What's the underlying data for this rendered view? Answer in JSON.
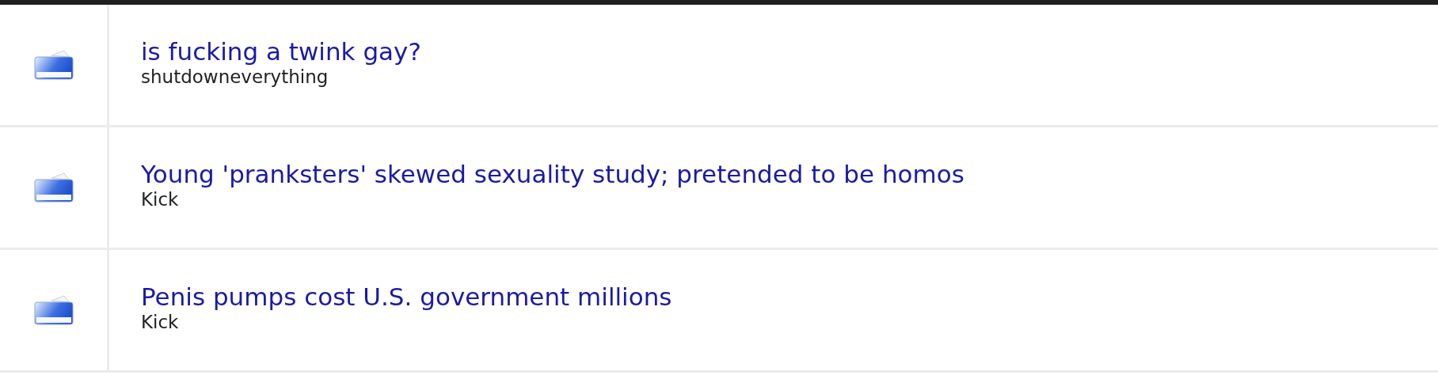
{
  "threads": [
    {
      "title": "is fucking a twink gay?",
      "author": "shutdowneverything"
    },
    {
      "title": "Young 'pranksters' skewed sexuality study; pretended to be homos",
      "author": "Kick"
    },
    {
      "title": "Penis pumps cost U.S. government millions",
      "author": "Kick"
    }
  ]
}
